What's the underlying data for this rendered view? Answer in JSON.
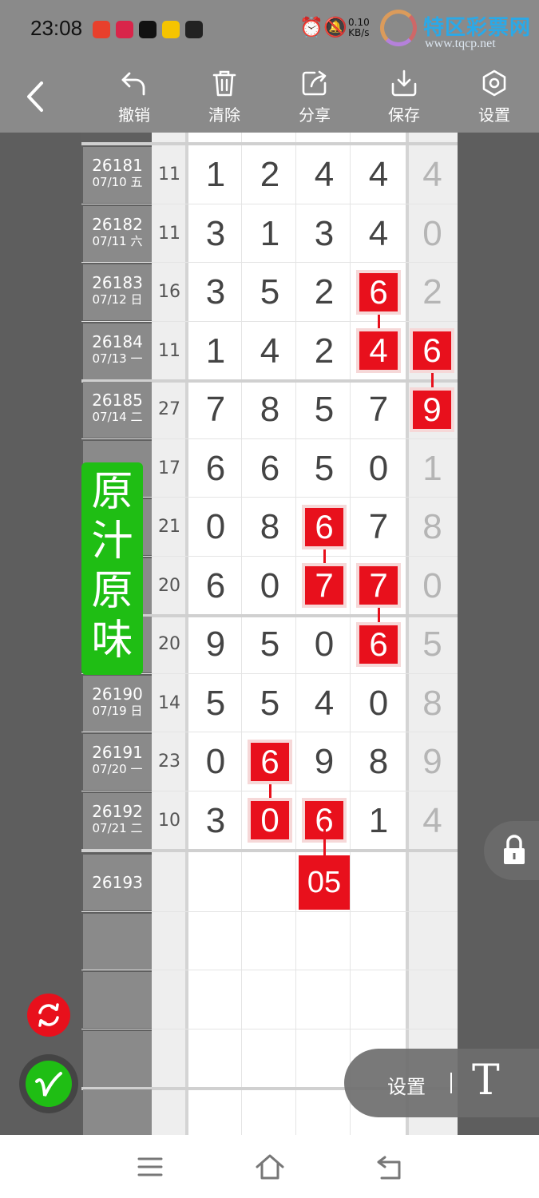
{
  "status_bar": {
    "time": "23:08",
    "net_speed": "0.10",
    "net_unit": "KB/s",
    "app_icons": [
      "#e8402c",
      "#d9254a",
      "#111111",
      "#f5c400",
      "#222222"
    ],
    "watermark_text": "特区彩票网",
    "watermark_url": "www.tqcp.net"
  },
  "toolbar": {
    "back_icon": "chevron-left-icon",
    "undo_label": "撤销",
    "clear_label": "清除",
    "share_label": "分享",
    "save_label": "保存",
    "settings_label": "设置"
  },
  "rows": [
    {
      "issue": "26181",
      "date": "07/10 五",
      "sum": "11",
      "digits": [
        "1",
        "2",
        "4",
        "4"
      ],
      "last": "4"
    },
    {
      "issue": "26182",
      "date": "07/11 六",
      "sum": "11",
      "digits": [
        "3",
        "1",
        "3",
        "4"
      ],
      "last": "0"
    },
    {
      "issue": "26183",
      "date": "07/12 日",
      "sum": "16",
      "digits": [
        "3",
        "5",
        "2",
        "6"
      ],
      "last": "2"
    },
    {
      "issue": "26184",
      "date": "07/13 一",
      "sum": "11",
      "digits": [
        "1",
        "4",
        "2",
        "4"
      ],
      "last": "6"
    },
    {
      "issue": "26185",
      "date": "07/14 二",
      "sum": "27",
      "digits": [
        "7",
        "8",
        "5",
        "7"
      ],
      "last": "9"
    },
    {
      "issue": "",
      "date": "",
      "sum": "17",
      "digits": [
        "6",
        "6",
        "5",
        "0"
      ],
      "last": "1"
    },
    {
      "issue": "",
      "date": "",
      "sum": "21",
      "digits": [
        "0",
        "8",
        "6",
        "7"
      ],
      "last": "8"
    },
    {
      "issue": "",
      "date": "",
      "sum": "20",
      "digits": [
        "6",
        "0",
        "7",
        "7"
      ],
      "last": "0"
    },
    {
      "issue": "",
      "date": "",
      "sum": "20",
      "digits": [
        "9",
        "5",
        "0",
        "6"
      ],
      "last": "5"
    },
    {
      "issue": "26190",
      "date": "07/19 日",
      "sum": "14",
      "digits": [
        "5",
        "5",
        "4",
        "0"
      ],
      "last": "8"
    },
    {
      "issue": "26191",
      "date": "07/20 一",
      "sum": "23",
      "digits": [
        "0",
        "6",
        "9",
        "8"
      ],
      "last": "9"
    },
    {
      "issue": "26192",
      "date": "07/21 二",
      "sum": "10",
      "digits": [
        "3",
        "0",
        "6",
        "1"
      ],
      "last": "4"
    }
  ],
  "marked_cells": [
    {
      "row": 2,
      "col": 3
    },
    {
      "row": 3,
      "col": 3
    },
    {
      "row": 3,
      "col": 4
    },
    {
      "row": 4,
      "col": 4
    },
    {
      "row": 6,
      "col": 2
    },
    {
      "row": 7,
      "col": 2
    },
    {
      "row": 7,
      "col": 3
    },
    {
      "row": 8,
      "col": 3
    },
    {
      "row": 10,
      "col": 1
    },
    {
      "row": 11,
      "col": 1
    },
    {
      "row": 11,
      "col": 2
    }
  ],
  "connectors": [
    {
      "col": 3,
      "from": 2,
      "to": 3
    },
    {
      "col": 4,
      "from": 3,
      "to": 4
    },
    {
      "col": 2,
      "from": 6,
      "to": 7
    },
    {
      "col": 3,
      "from": 7,
      "to": 8
    },
    {
      "col": 1,
      "from": 10,
      "to": 11
    }
  ],
  "next_issue": "26193",
  "prediction": "05",
  "stamp_text": "原汁原味",
  "text_tool": {
    "settings_label": "设置",
    "tool_glyph": "T"
  },
  "colors": {
    "mark_red": "#e8101c",
    "stamp_green": "#1fbe14",
    "toolbar_gray": "#8a8a8a"
  }
}
